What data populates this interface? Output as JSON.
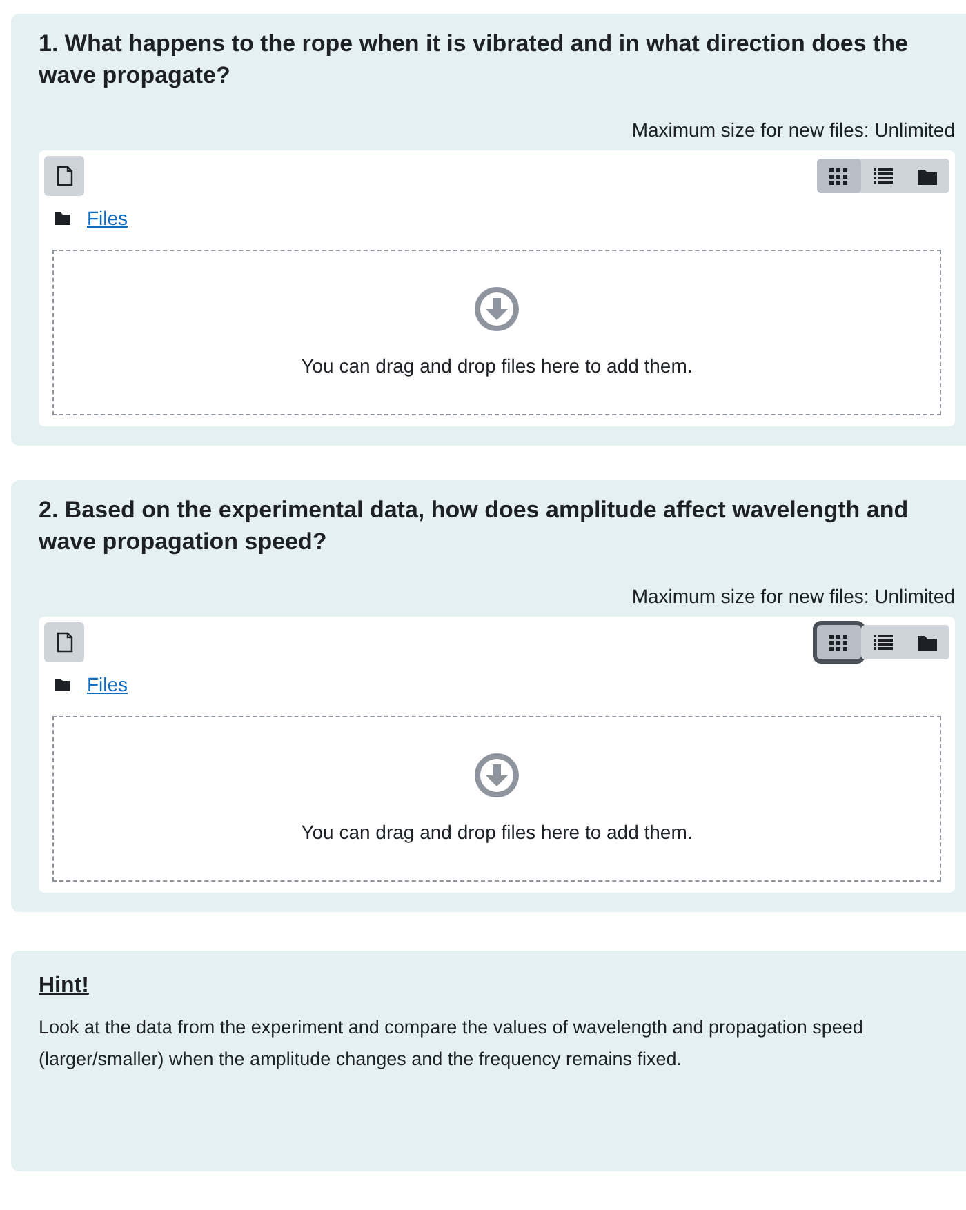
{
  "questions": [
    {
      "title": "1. What happens to the rope when it is vibrated and in what direction does the wave propagate?",
      "max_size": "Maximum size for new files: Unlimited",
      "path": "Files",
      "dropzone": "You can drag and drop files here to add them.",
      "views": [
        {
          "kind": "icons",
          "selected": true,
          "focused": false
        },
        {
          "kind": "details",
          "selected": false,
          "focused": false
        },
        {
          "kind": "tree",
          "selected": false,
          "focused": false
        }
      ]
    },
    {
      "title": "2. Based on the experimental data, how does amplitude affect wavelength and wave propagation speed?",
      "max_size": "Maximum size for new files: Unlimited",
      "path": "Files",
      "dropzone": "You can drag and drop files here to add them.",
      "views": [
        {
          "kind": "icons",
          "selected": true,
          "focused": true
        },
        {
          "kind": "details",
          "selected": false,
          "focused": false
        },
        {
          "kind": "tree",
          "selected": false,
          "focused": false
        }
      ]
    }
  ],
  "hint": {
    "title": "Hint!",
    "text": "Look at the data from the experiment and compare the values of wavelength and propagation speed (larger/smaller) when the amplitude changes and the frequency remains fixed."
  }
}
